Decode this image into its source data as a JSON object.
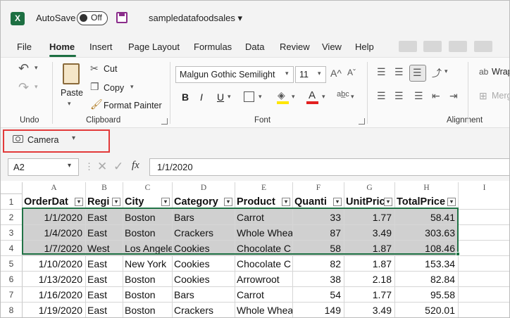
{
  "titlebar": {
    "autosave_label": "AutoSave",
    "toggle_state": "Off",
    "file_name": "sampledatafoodsales ▾"
  },
  "tabs": [
    "File",
    "Home",
    "Insert",
    "Page Layout",
    "Formulas",
    "Data",
    "Review",
    "View",
    "Help"
  ],
  "ribbon": {
    "undo_label": "Undo",
    "paste_label": "Paste",
    "cut_label": "Cut",
    "copy_label": "Copy",
    "format_painter_label": "Format Painter",
    "clipboard_label": "Clipboard",
    "font_name": "Malgun Gothic Semilight",
    "font_size": "11",
    "font_label": "Font",
    "bold": "B",
    "italic": "I",
    "underline": "U",
    "alignment_label": "Alignment",
    "wrap_label": "Wrap",
    "merge_label": "Merg"
  },
  "camera": {
    "label": "Camera"
  },
  "formula": {
    "name_box": "A2",
    "value": "1/1/2020"
  },
  "columns": [
    "A",
    "B",
    "C",
    "D",
    "E",
    "F",
    "G",
    "H",
    "I"
  ],
  "rows": [
    "1",
    "2",
    "3",
    "4",
    "5",
    "6",
    "7",
    "8"
  ],
  "header_row": [
    "OrderDat",
    "Regi",
    "City",
    "Category",
    "Product",
    "Quanti",
    "UnitPric",
    "TotalPrice"
  ],
  "data_rows": [
    [
      "1/1/2020",
      "East",
      "Boston",
      "Bars",
      "Carrot",
      "33",
      "1.77",
      "58.41"
    ],
    [
      "1/4/2020",
      "East",
      "Boston",
      "Crackers",
      "Whole Whea",
      "87",
      "3.49",
      "303.63"
    ],
    [
      "1/7/2020",
      "West",
      "Los Angele",
      "Cookies",
      "Chocolate C",
      "58",
      "1.87",
      "108.46"
    ],
    [
      "1/10/2020",
      "East",
      "New York",
      "Cookies",
      "Chocolate C",
      "82",
      "1.87",
      "153.34"
    ],
    [
      "1/13/2020",
      "East",
      "Boston",
      "Cookies",
      "Arrowroot",
      "38",
      "2.18",
      "82.84"
    ],
    [
      "1/16/2020",
      "East",
      "Boston",
      "Bars",
      "Carrot",
      "54",
      "1.77",
      "95.58"
    ],
    [
      "1/19/2020",
      "East",
      "Boston",
      "Crackers",
      "Whole Whea",
      "149",
      "3.49",
      "520.01"
    ]
  ],
  "selected_rows": [
    0,
    1,
    2
  ],
  "colors": {
    "excel_green": "#217346",
    "selection_fill": "#d0d0d0",
    "highlight_red": "#e23a3a"
  }
}
